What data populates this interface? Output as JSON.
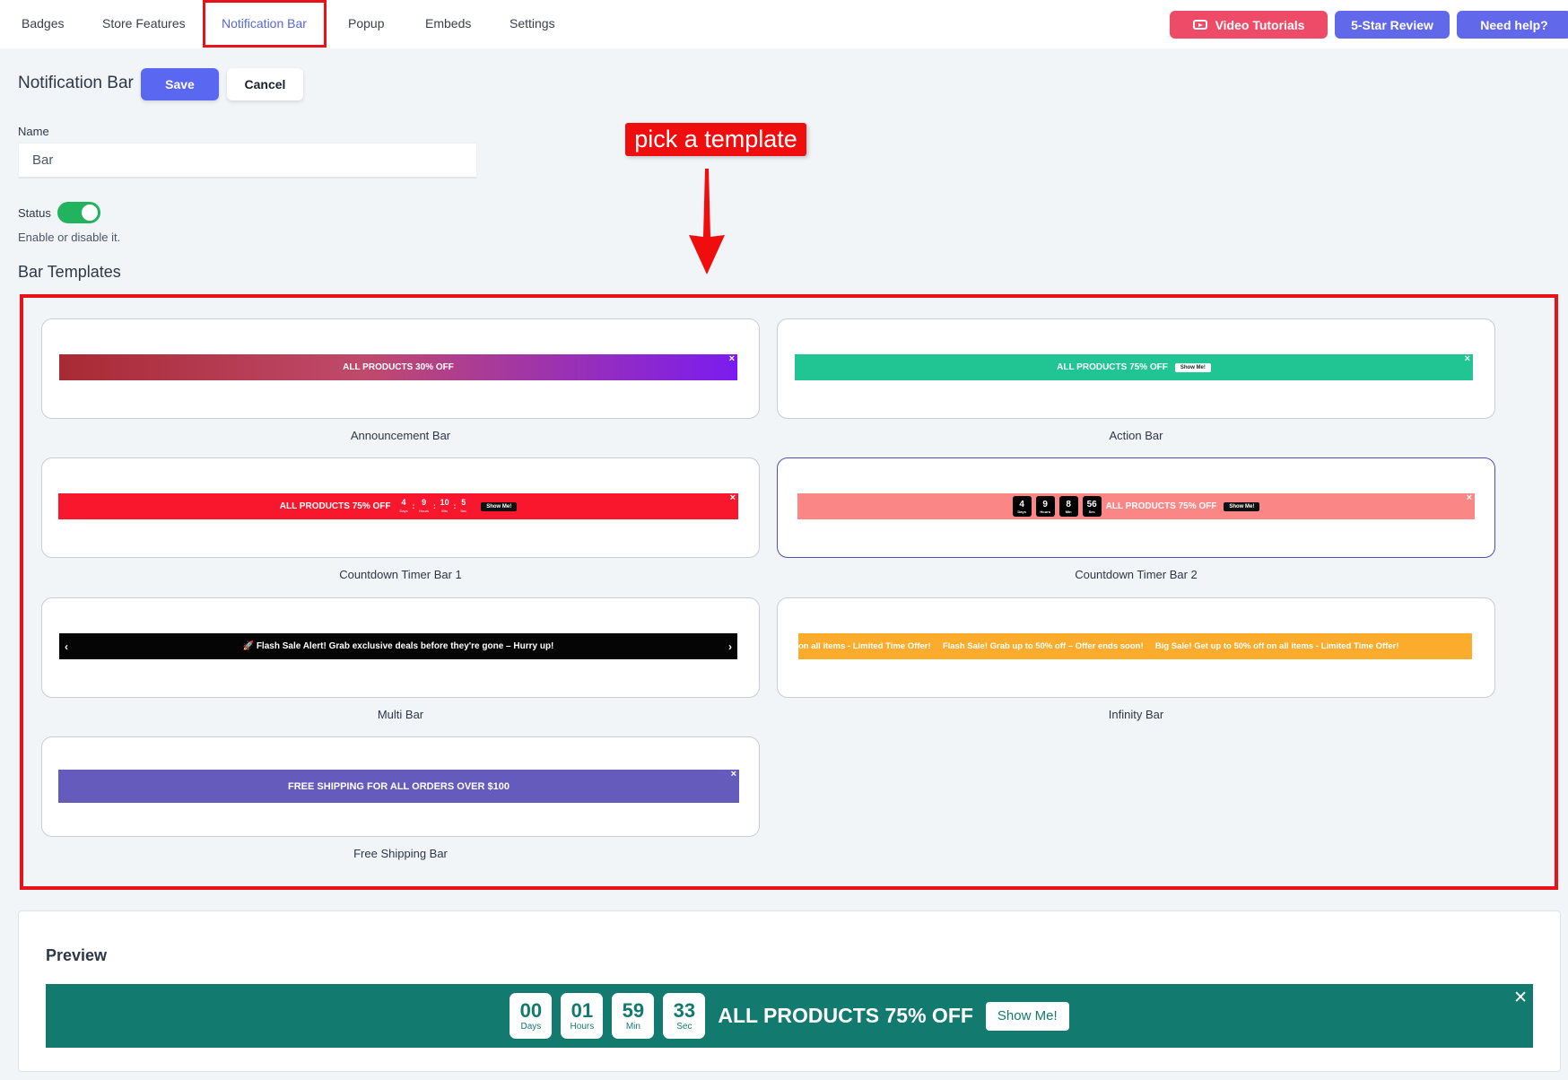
{
  "nav": {
    "tabs": [
      "Badges",
      "Store Features",
      "Notification Bar",
      "Popup",
      "Embeds",
      "Settings"
    ],
    "active_tab": "Notification Bar",
    "video_tutorials": "Video Tutorials",
    "review": "5-Star Review",
    "help": "Need help?"
  },
  "header": {
    "title": "Notification Bar",
    "save": "Save",
    "cancel": "Cancel"
  },
  "form": {
    "name_label": "Name",
    "name_value": "Bar",
    "status_label": "Status",
    "status_on": true,
    "status_help": "Enable or disable it."
  },
  "annotation": {
    "text": "pick a template"
  },
  "templates": {
    "title": "Bar Templates",
    "items": [
      {
        "name": "Announcement Bar",
        "bar_text": "ALL PRODUCTS 30% OFF"
      },
      {
        "name": "Action Bar",
        "bar_text": "ALL PRODUCTS 75% OFF",
        "button": "Show Me!"
      },
      {
        "name": "Countdown Timer Bar 1",
        "bar_text": "ALL PRODUCTS 75% OFF",
        "button": "Show Me!",
        "timer": [
          [
            "4",
            "Days"
          ],
          [
            "9",
            "Hours"
          ],
          [
            "10",
            "Min"
          ],
          [
            "5",
            "Sec"
          ]
        ]
      },
      {
        "name": "Countdown Timer Bar 2",
        "bar_text": "ALL PRODUCTS 75% OFF",
        "button": "Show Me!",
        "timer": [
          [
            "4",
            "Days"
          ],
          [
            "9",
            "Hours"
          ],
          [
            "8",
            "Min"
          ],
          [
            "56",
            "Sec"
          ]
        ]
      },
      {
        "name": "Multi Bar",
        "bar_text": "🚀 Flash Sale Alert! Grab exclusive deals before they're gone – Hurry up!"
      },
      {
        "name": "Infinity Bar",
        "bar_text": "on all items - Limited Time Offer!     Flash Sale! Grab up to 50% off – Offer ends soon!     Big Sale! Get up to 50% off on all items - Limited Time Offer!"
      },
      {
        "name": "Free Shipping Bar",
        "bar_text": "FREE SHIPPING FOR ALL ORDERS OVER $100"
      }
    ]
  },
  "preview": {
    "title": "Preview",
    "timer": [
      {
        "value": "00",
        "unit": "Days"
      },
      {
        "value": "01",
        "unit": "Hours"
      },
      {
        "value": "59",
        "unit": "Min"
      },
      {
        "value": "33",
        "unit": "Sec"
      }
    ],
    "text": "ALL PRODUCTS 75% OFF",
    "button": "Show Me!"
  },
  "colors": {
    "accent": "#5a67f0",
    "video_button": "#ee4b68",
    "toggle_on": "#22b35e",
    "annotation": "#e8121a",
    "preview_bar": "#137a6f"
  }
}
